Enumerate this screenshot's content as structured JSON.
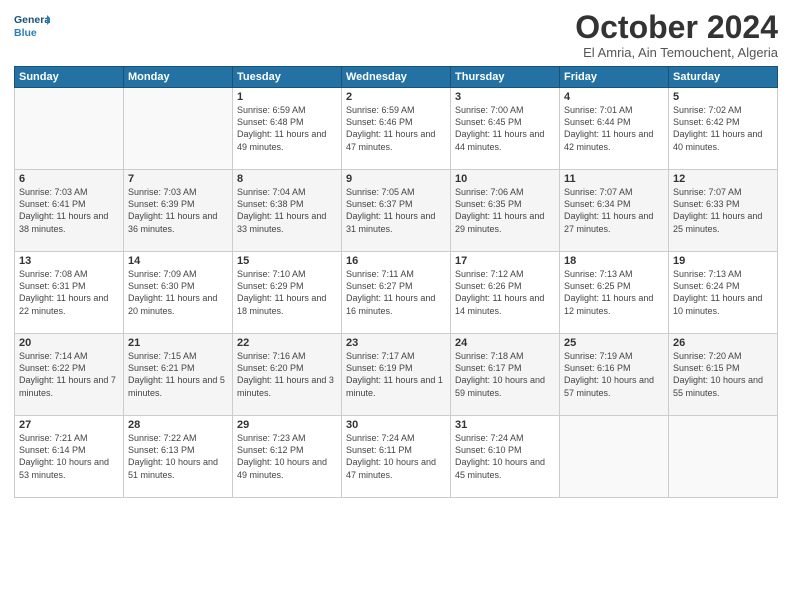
{
  "logo": {
    "line1": "General",
    "line2": "Blue"
  },
  "title": "October 2024",
  "subtitle": "El Amria, Ain Temouchent, Algeria",
  "weekdays": [
    "Sunday",
    "Monday",
    "Tuesday",
    "Wednesday",
    "Thursday",
    "Friday",
    "Saturday"
  ],
  "weeks": [
    [
      {
        "day": "",
        "sunrise": "",
        "sunset": "",
        "daylight": ""
      },
      {
        "day": "",
        "sunrise": "",
        "sunset": "",
        "daylight": ""
      },
      {
        "day": "1",
        "sunrise": "Sunrise: 6:59 AM",
        "sunset": "Sunset: 6:48 PM",
        "daylight": "Daylight: 11 hours and 49 minutes."
      },
      {
        "day": "2",
        "sunrise": "Sunrise: 6:59 AM",
        "sunset": "Sunset: 6:46 PM",
        "daylight": "Daylight: 11 hours and 47 minutes."
      },
      {
        "day": "3",
        "sunrise": "Sunrise: 7:00 AM",
        "sunset": "Sunset: 6:45 PM",
        "daylight": "Daylight: 11 hours and 44 minutes."
      },
      {
        "day": "4",
        "sunrise": "Sunrise: 7:01 AM",
        "sunset": "Sunset: 6:44 PM",
        "daylight": "Daylight: 11 hours and 42 minutes."
      },
      {
        "day": "5",
        "sunrise": "Sunrise: 7:02 AM",
        "sunset": "Sunset: 6:42 PM",
        "daylight": "Daylight: 11 hours and 40 minutes."
      }
    ],
    [
      {
        "day": "6",
        "sunrise": "Sunrise: 7:03 AM",
        "sunset": "Sunset: 6:41 PM",
        "daylight": "Daylight: 11 hours and 38 minutes."
      },
      {
        "day": "7",
        "sunrise": "Sunrise: 7:03 AM",
        "sunset": "Sunset: 6:39 PM",
        "daylight": "Daylight: 11 hours and 36 minutes."
      },
      {
        "day": "8",
        "sunrise": "Sunrise: 7:04 AM",
        "sunset": "Sunset: 6:38 PM",
        "daylight": "Daylight: 11 hours and 33 minutes."
      },
      {
        "day": "9",
        "sunrise": "Sunrise: 7:05 AM",
        "sunset": "Sunset: 6:37 PM",
        "daylight": "Daylight: 11 hours and 31 minutes."
      },
      {
        "day": "10",
        "sunrise": "Sunrise: 7:06 AM",
        "sunset": "Sunset: 6:35 PM",
        "daylight": "Daylight: 11 hours and 29 minutes."
      },
      {
        "day": "11",
        "sunrise": "Sunrise: 7:07 AM",
        "sunset": "Sunset: 6:34 PM",
        "daylight": "Daylight: 11 hours and 27 minutes."
      },
      {
        "day": "12",
        "sunrise": "Sunrise: 7:07 AM",
        "sunset": "Sunset: 6:33 PM",
        "daylight": "Daylight: 11 hours and 25 minutes."
      }
    ],
    [
      {
        "day": "13",
        "sunrise": "Sunrise: 7:08 AM",
        "sunset": "Sunset: 6:31 PM",
        "daylight": "Daylight: 11 hours and 22 minutes."
      },
      {
        "day": "14",
        "sunrise": "Sunrise: 7:09 AM",
        "sunset": "Sunset: 6:30 PM",
        "daylight": "Daylight: 11 hours and 20 minutes."
      },
      {
        "day": "15",
        "sunrise": "Sunrise: 7:10 AM",
        "sunset": "Sunset: 6:29 PM",
        "daylight": "Daylight: 11 hours and 18 minutes."
      },
      {
        "day": "16",
        "sunrise": "Sunrise: 7:11 AM",
        "sunset": "Sunset: 6:27 PM",
        "daylight": "Daylight: 11 hours and 16 minutes."
      },
      {
        "day": "17",
        "sunrise": "Sunrise: 7:12 AM",
        "sunset": "Sunset: 6:26 PM",
        "daylight": "Daylight: 11 hours and 14 minutes."
      },
      {
        "day": "18",
        "sunrise": "Sunrise: 7:13 AM",
        "sunset": "Sunset: 6:25 PM",
        "daylight": "Daylight: 11 hours and 12 minutes."
      },
      {
        "day": "19",
        "sunrise": "Sunrise: 7:13 AM",
        "sunset": "Sunset: 6:24 PM",
        "daylight": "Daylight: 11 hours and 10 minutes."
      }
    ],
    [
      {
        "day": "20",
        "sunrise": "Sunrise: 7:14 AM",
        "sunset": "Sunset: 6:22 PM",
        "daylight": "Daylight: 11 hours and 7 minutes."
      },
      {
        "day": "21",
        "sunrise": "Sunrise: 7:15 AM",
        "sunset": "Sunset: 6:21 PM",
        "daylight": "Daylight: 11 hours and 5 minutes."
      },
      {
        "day": "22",
        "sunrise": "Sunrise: 7:16 AM",
        "sunset": "Sunset: 6:20 PM",
        "daylight": "Daylight: 11 hours and 3 minutes."
      },
      {
        "day": "23",
        "sunrise": "Sunrise: 7:17 AM",
        "sunset": "Sunset: 6:19 PM",
        "daylight": "Daylight: 11 hours and 1 minute."
      },
      {
        "day": "24",
        "sunrise": "Sunrise: 7:18 AM",
        "sunset": "Sunset: 6:17 PM",
        "daylight": "Daylight: 10 hours and 59 minutes."
      },
      {
        "day": "25",
        "sunrise": "Sunrise: 7:19 AM",
        "sunset": "Sunset: 6:16 PM",
        "daylight": "Daylight: 10 hours and 57 minutes."
      },
      {
        "day": "26",
        "sunrise": "Sunrise: 7:20 AM",
        "sunset": "Sunset: 6:15 PM",
        "daylight": "Daylight: 10 hours and 55 minutes."
      }
    ],
    [
      {
        "day": "27",
        "sunrise": "Sunrise: 7:21 AM",
        "sunset": "Sunset: 6:14 PM",
        "daylight": "Daylight: 10 hours and 53 minutes."
      },
      {
        "day": "28",
        "sunrise": "Sunrise: 7:22 AM",
        "sunset": "Sunset: 6:13 PM",
        "daylight": "Daylight: 10 hours and 51 minutes."
      },
      {
        "day": "29",
        "sunrise": "Sunrise: 7:23 AM",
        "sunset": "Sunset: 6:12 PM",
        "daylight": "Daylight: 10 hours and 49 minutes."
      },
      {
        "day": "30",
        "sunrise": "Sunrise: 7:24 AM",
        "sunset": "Sunset: 6:11 PM",
        "daylight": "Daylight: 10 hours and 47 minutes."
      },
      {
        "day": "31",
        "sunrise": "Sunrise: 7:24 AM",
        "sunset": "Sunset: 6:10 PM",
        "daylight": "Daylight: 10 hours and 45 minutes."
      },
      {
        "day": "",
        "sunrise": "",
        "sunset": "",
        "daylight": ""
      },
      {
        "day": "",
        "sunrise": "",
        "sunset": "",
        "daylight": ""
      }
    ]
  ]
}
